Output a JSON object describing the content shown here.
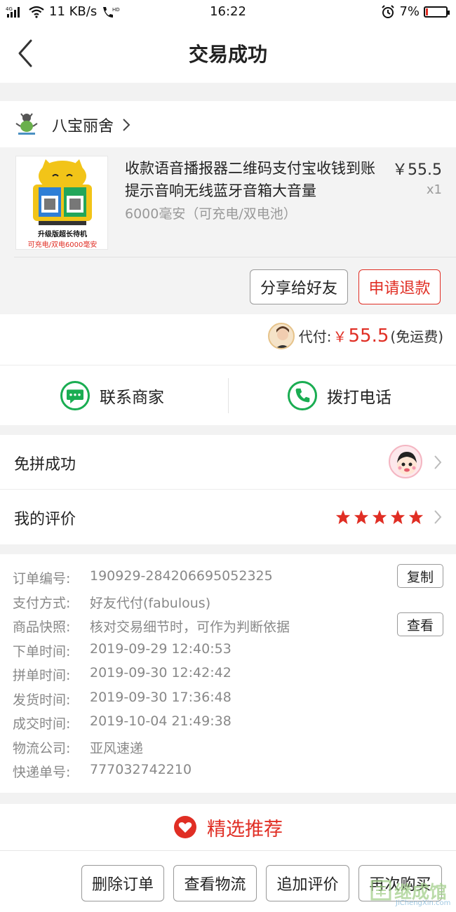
{
  "status_bar": {
    "network": "4G",
    "speed": "11 KB/s",
    "hd": "HD",
    "time": "16:22",
    "battery": "7%"
  },
  "header": {
    "title": "交易成功",
    "back_icon": "chevron-left-icon"
  },
  "shop": {
    "name": "八宝丽舍"
  },
  "goods": {
    "title": "收款语音播报器二维码支付宝收钱到账提示音响无线蓝牙音箱大音量",
    "spec": "6000毫安（可充电/双电池）",
    "price": "￥55.5",
    "qty": "x1",
    "image_caption_1": "升级版超长待机",
    "image_caption_2": "可充电/双电6000毫安",
    "share_button": "分享给好友",
    "refund_button": "申请退款"
  },
  "payment": {
    "label": "代付:",
    "currency": "￥",
    "amount": "55.5",
    "note": "(免运费)"
  },
  "contact": {
    "merchant_label": "联系商家",
    "call_label": "拨打电话"
  },
  "group": {
    "label": "免拼成功"
  },
  "review": {
    "label": "我的评价",
    "stars": 5
  },
  "order_info": {
    "rows": [
      {
        "key": "订单编号:",
        "value": "190929-284206695052325",
        "action": "复制"
      },
      {
        "key": "支付方式:",
        "value": "好友代付(fabulous)"
      },
      {
        "key": "商品快照:",
        "value": "核对交易细节时，可作为判断依据",
        "action": "查看"
      },
      {
        "key": "下单时间:",
        "value": "2019-09-29 12:40:53"
      },
      {
        "key": "拼单时间:",
        "value": "2019-09-30 12:42:42"
      },
      {
        "key": "发货时间:",
        "value": "2019-09-30 17:36:48"
      },
      {
        "key": "成交时间:",
        "value": "2019-10-04 21:49:38"
      },
      {
        "key": "物流公司:",
        "value": "亚风速递"
      },
      {
        "key": "快递单号:",
        "value": "777032742210"
      }
    ]
  },
  "recommend": {
    "label": "精选推荐"
  },
  "bottom_bar": {
    "delete": "删除订单",
    "logistics": "查看物流",
    "add_review": "追加评价",
    "rebuy": "再次购买"
  },
  "watermark": {
    "text": "继成馆",
    "url": "JiChengXin.com"
  },
  "colors": {
    "accent": "#e02e24",
    "green": "#1aad52",
    "star": "#e02e24"
  }
}
